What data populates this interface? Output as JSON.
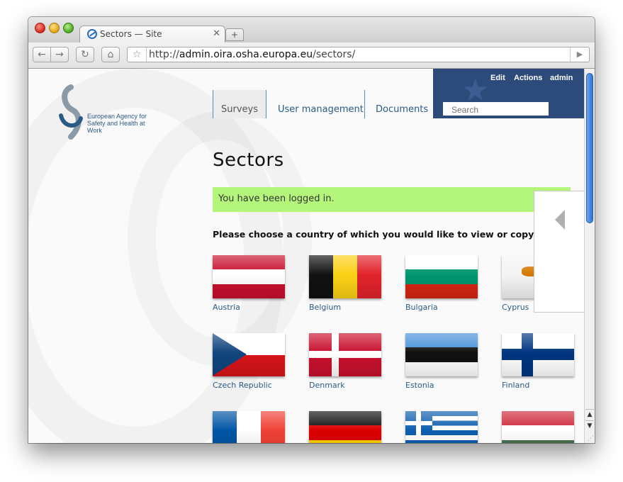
{
  "browser": {
    "tab_title": "Sectors — Site",
    "tab_close": "✕",
    "new_tab": "+",
    "url_scheme": "http://",
    "url_host": "admin.oira.osha.europa.eu",
    "url_path": "/sectors/",
    "back": "←",
    "forward": "→",
    "reload": "↻",
    "home": "⌂",
    "bookmark": "☆",
    "go": "▶"
  },
  "site": {
    "logo_text": "European Agency for Safety and Health at Work",
    "nav": [
      "Surveys",
      "User management",
      "Documents"
    ],
    "top_links": [
      "Edit",
      "Actions",
      "admin"
    ],
    "search_placeholder": "Search",
    "page_title": "Sectors",
    "status_message": "You have been logged in.",
    "prompt": "Please choose a country of which you would like to view or copy a survey.",
    "countries": [
      {
        "name": "Austria",
        "flag": "AT"
      },
      {
        "name": "Belgium",
        "flag": "BE"
      },
      {
        "name": "Bulgaria",
        "flag": "BG"
      },
      {
        "name": "Cyprus",
        "flag": "CY"
      },
      {
        "name": "Czech Republic",
        "flag": "CZ"
      },
      {
        "name": "Denmark",
        "flag": "DK"
      },
      {
        "name": "Estonia",
        "flag": "EE"
      },
      {
        "name": "Finland",
        "flag": "FI"
      },
      {
        "name": "",
        "flag": "FR"
      },
      {
        "name": "",
        "flag": "DE"
      },
      {
        "name": "",
        "flag": "GR"
      },
      {
        "name": "",
        "flag": "HU"
      }
    ]
  },
  "colors": {
    "header_blue": "#2c4a7a",
    "link_blue": "#2a5a86",
    "message_green": "#b4f57c"
  },
  "icons": {
    "side_panel": "collapse-arrow-icon"
  }
}
